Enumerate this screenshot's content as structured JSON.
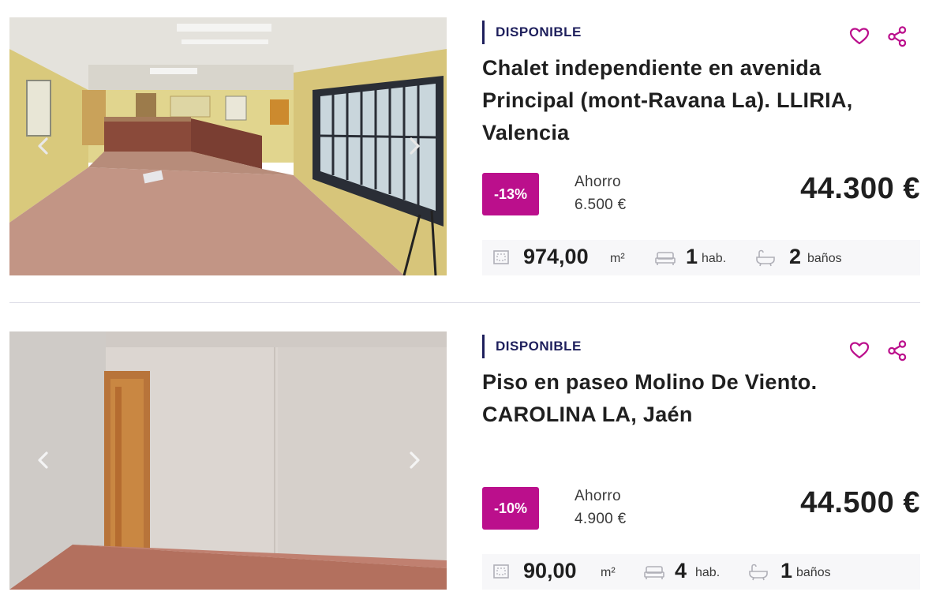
{
  "listings": [
    {
      "status": "DISPONIBLE",
      "title_lines": [
        "Chalet independiente en avenida",
        "Principal (mont-Ravana La). LLIRIA,",
        "Valencia"
      ],
      "discount": "-13%",
      "savings_label": "Ahorro",
      "savings_value": "6.500 €",
      "price": "44.300 €",
      "area_value": "974,00",
      "area_unit": "m²",
      "rooms_value": "1",
      "rooms_unit": "hab.",
      "baths_value": "2",
      "baths_unit": "baños",
      "icons": {
        "favorite": "heart-icon",
        "share": "share-icon",
        "area": "area-icon",
        "rooms": "bed-icon",
        "baths": "bathtub-icon",
        "prev": "chevron-left-icon",
        "next": "chevron-right-icon"
      }
    },
    {
      "status": "DISPONIBLE",
      "title_lines": [
        "Piso en paseo Molino De Viento.",
        "CAROLINA LA, Jaén"
      ],
      "discount": "-10%",
      "savings_label": "Ahorro",
      "savings_value": "4.900 €",
      "price": "44.500 €",
      "area_value": "90,00",
      "area_unit": "m²",
      "rooms_value": "4",
      "rooms_unit": "hab.",
      "baths_value": "1",
      "baths_unit": "baños",
      "icons": {
        "favorite": "heart-icon",
        "share": "share-icon",
        "area": "area-icon",
        "rooms": "bed-icon",
        "baths": "bathtub-icon",
        "prev": "chevron-left-icon",
        "next": "chevron-right-icon"
      }
    }
  ],
  "colors": {
    "accent": "#bb0f8c",
    "navy": "#1e1f5c",
    "text": "#1f1f1f"
  }
}
